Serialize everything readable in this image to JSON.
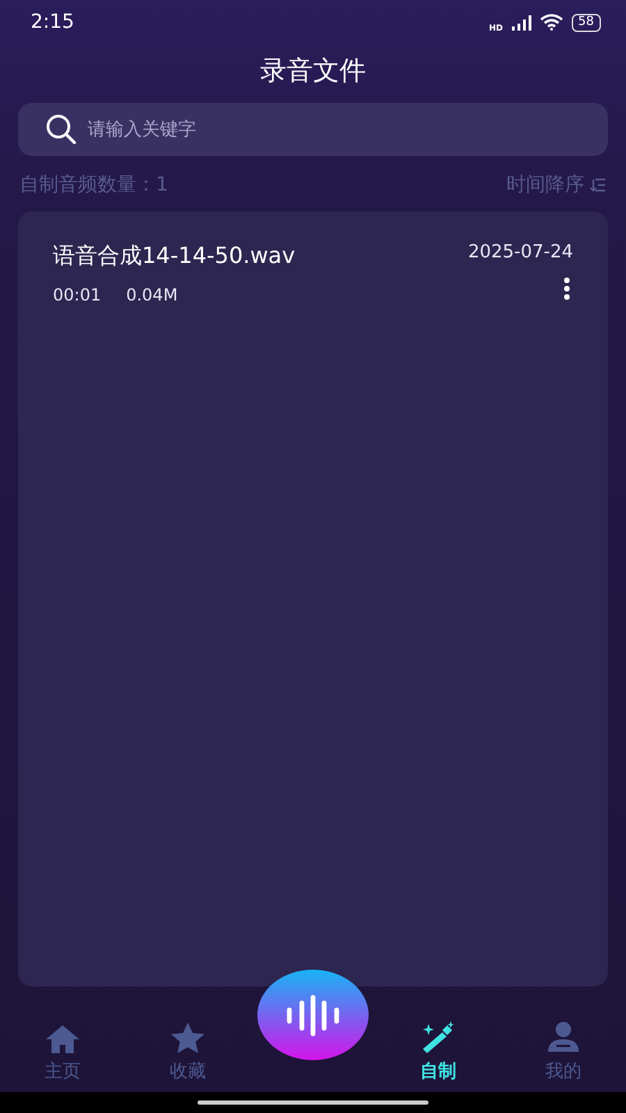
{
  "status_bar": {
    "time": "2:15",
    "network": "HD",
    "battery": "58"
  },
  "header": {
    "title": "录音文件"
  },
  "search": {
    "placeholder": "请输入关键字"
  },
  "summary": {
    "count_label": "自制音频数量：1",
    "sort_label": "时间降序"
  },
  "files": [
    {
      "name": "语音合成14-14-50.wav",
      "date": "2025-07-24",
      "duration": "00:01",
      "size": "0.04M"
    }
  ],
  "nav": {
    "items": [
      {
        "label": "主页",
        "selected": false
      },
      {
        "label": "收藏",
        "selected": false
      },
      {
        "label": "自制",
        "selected": true
      },
      {
        "label": "我的",
        "selected": false
      }
    ]
  }
}
